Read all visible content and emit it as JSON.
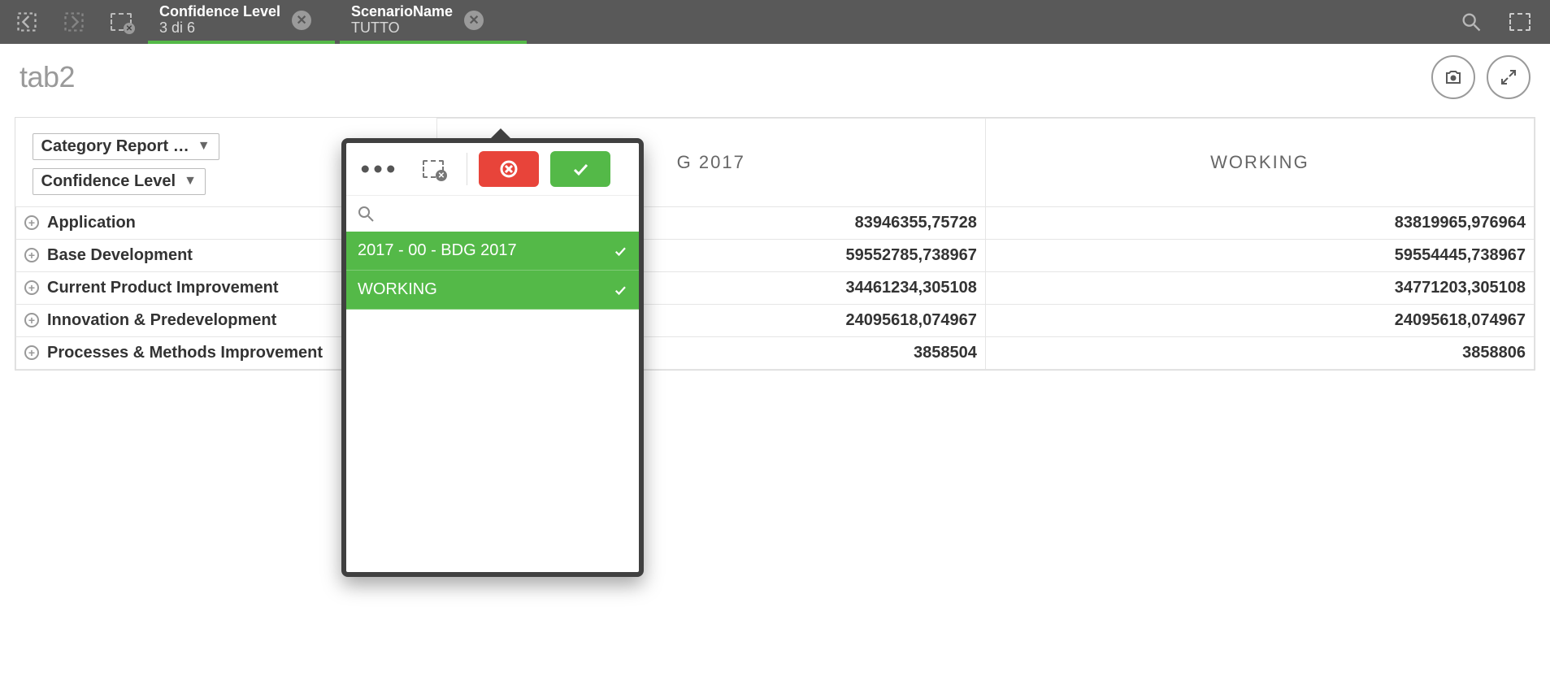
{
  "topbar": {
    "pills": [
      {
        "title": "Confidence Level",
        "sub": "3 di 6"
      },
      {
        "title": "ScenarioName",
        "sub": "TUTTO"
      }
    ]
  },
  "sheet": {
    "title": "tab2"
  },
  "table": {
    "chip1": "Category Report …",
    "chip2": "Confidence Level",
    "columns": [
      {
        "key": "c1",
        "label": "G 2017"
      },
      {
        "key": "c2",
        "label": "WORKING"
      }
    ],
    "rows": [
      {
        "label": "Application",
        "c1": "83946355,75728",
        "c2": "83819965,976964"
      },
      {
        "label": "Base Development",
        "c1": "59552785,738967",
        "c2": "59554445,738967"
      },
      {
        "label": "Current Product Improvement",
        "c1": "34461234,305108",
        "c2": "34771203,305108"
      },
      {
        "label": "Innovation & Predevelopment",
        "c1": "24095618,074967",
        "c2": "24095618,074967"
      },
      {
        "label": "Processes & Methods Improvement",
        "c1": "3858504",
        "c2": "3858806"
      }
    ]
  },
  "popup": {
    "items": [
      {
        "label": "2017 - 00 - BDG 2017"
      },
      {
        "label": "WORKING"
      }
    ]
  }
}
